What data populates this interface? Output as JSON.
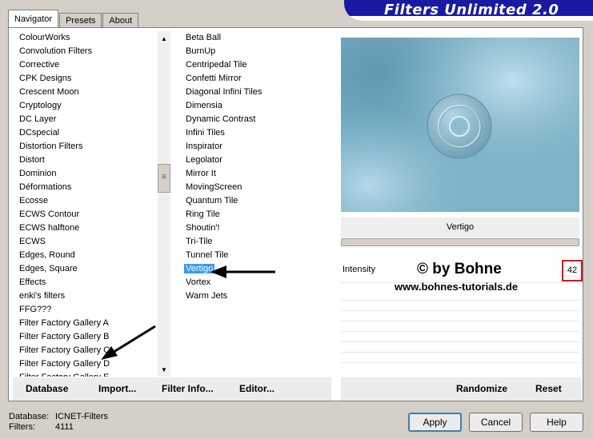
{
  "tabs": [
    "Navigator",
    "Presets",
    "About"
  ],
  "logo": "Filters Unlimited 2.0",
  "categories": [
    "ColourWorks",
    "Convolution Filters",
    "Corrective",
    "CPK Designs",
    "Crescent Moon",
    "Cryptology",
    "DC Layer",
    "DCspecial",
    "Distortion Filters",
    "Distort",
    "Dominion",
    "Déformations",
    "Ecosse",
    "ECWS Contour",
    "ECWS halftone",
    "ECWS",
    "Edges, Round",
    "Edges, Square",
    "Effects",
    "enki's filters",
    "FFG???",
    "Filter Factory Gallery A",
    "Filter Factory Gallery B",
    "Filter Factory Gallery C",
    "Filter Factory Gallery D",
    "Filter Factory Gallery E"
  ],
  "filters": [
    "Beta Ball",
    "BurnUp",
    "Centripedal Tile",
    "Confetti Mirror",
    "Diagonal Infini Tiles",
    "Dimensia",
    "Dynamic Contrast",
    "Infini Tiles",
    "Inspirator",
    "Legolator",
    "Mirror It",
    "MovingScreen",
    "Quantum Tile",
    "Ring Tile",
    "Shoutin'!",
    "Tri-Tile",
    "Tunnel Tile",
    "Vertigo",
    "Vortex",
    "Warm Jets"
  ],
  "selected_filter": "Vertigo",
  "preview": {
    "filter_name": "Vertigo"
  },
  "params": {
    "intensity_label": "Intensity",
    "intensity_value": "42"
  },
  "watermark": {
    "line1": "© by Bohne",
    "line2": "www.bohnes-tutorials.de"
  },
  "buttons_left": {
    "database": "Database",
    "import": "Import...",
    "filter_info": "Filter Info...",
    "editor": "Editor..."
  },
  "buttons_right": {
    "randomize": "Randomize",
    "reset": "Reset"
  },
  "status": {
    "database_label": "Database:",
    "database_value": "ICNET-Filters",
    "filters_label": "Filters:",
    "filters_value": "4111"
  },
  "dialog_buttons": {
    "apply": "Apply",
    "cancel": "Cancel",
    "help": "Help"
  },
  "colors": {
    "selection": "#3399ff",
    "logo_bg": "#1a1aa0",
    "highlight_box": "#e01010"
  }
}
